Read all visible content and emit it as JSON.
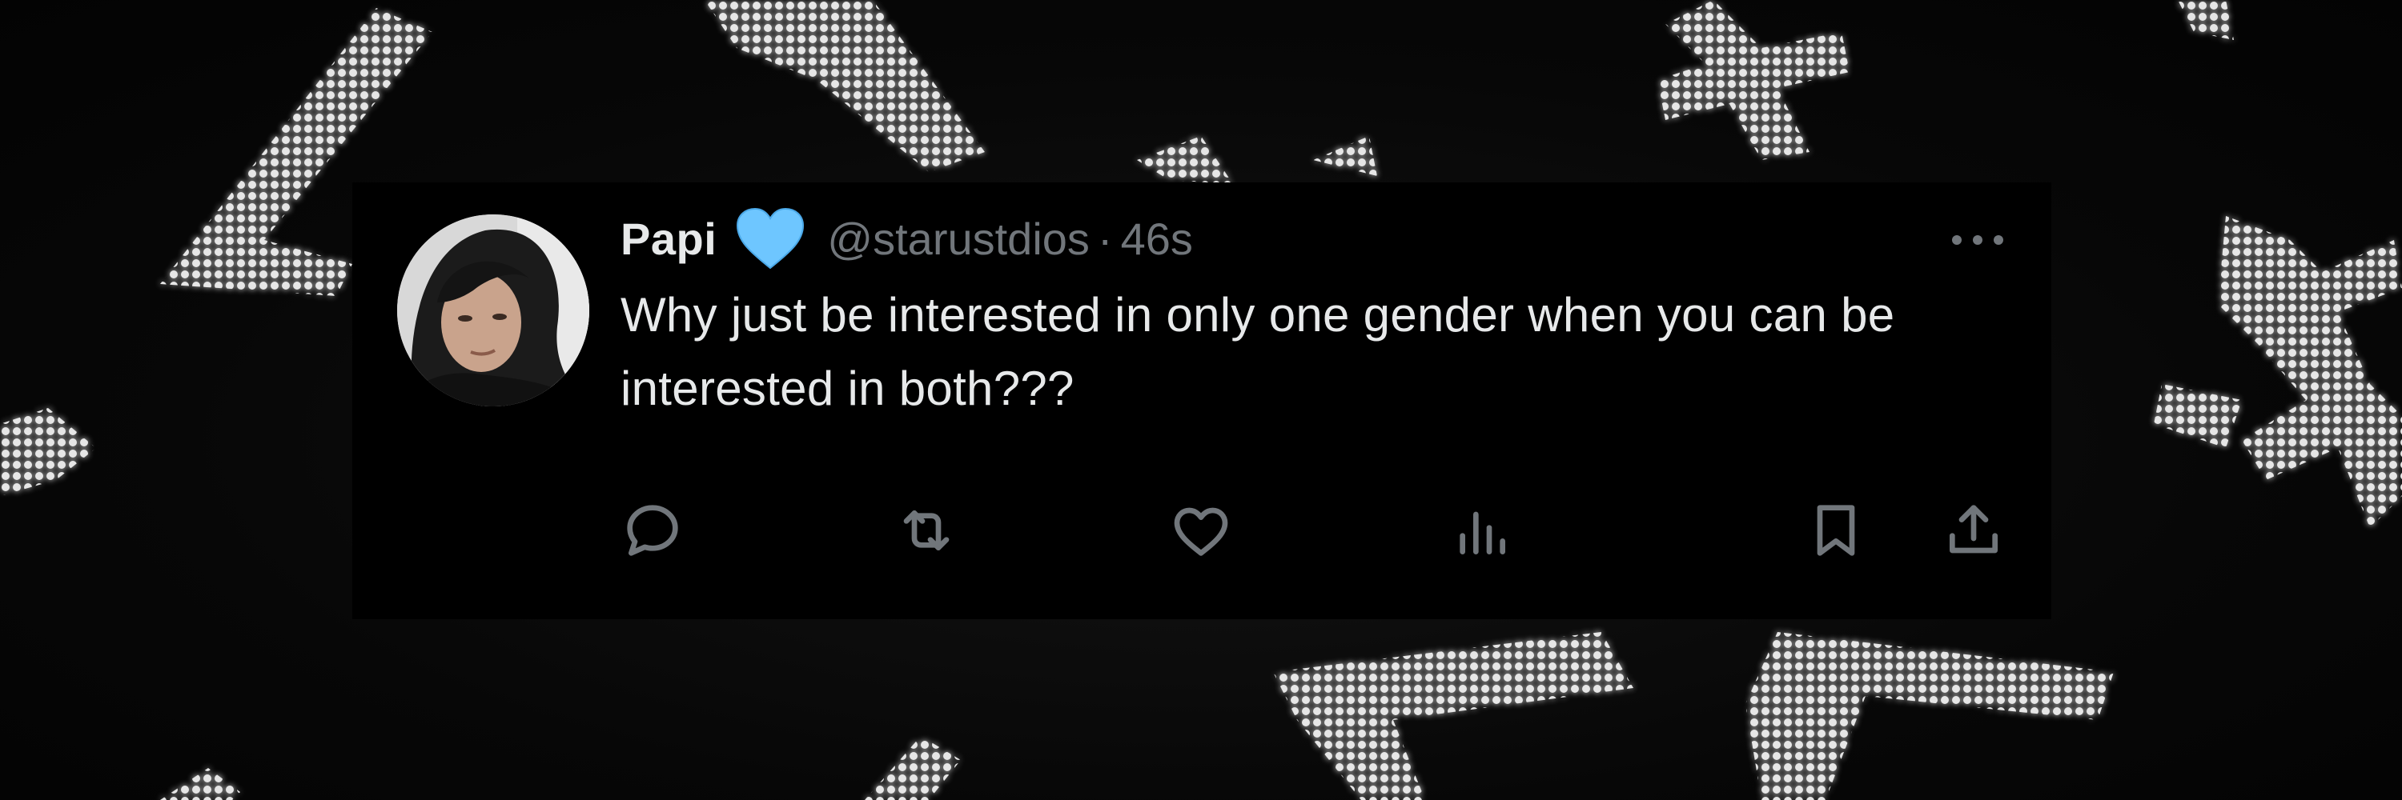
{
  "tweet": {
    "display_name": "Papi",
    "badge_icon": "blue-heart-emoji",
    "badge_color": "#6ec6ff",
    "handle": "@starustdios",
    "separator": "·",
    "timestamp": "46s",
    "text": "Why just be interested in only one gender when you can be interested in both???",
    "more_icon": "more-horizontal-icon",
    "actions": {
      "reply_icon": "reply-icon",
      "retweet_icon": "retweet-icon",
      "like_icon": "heart-icon",
      "views_icon": "views-chart-icon",
      "bookmark_icon": "bookmark-icon",
      "share_icon": "share-icon"
    }
  },
  "colors": {
    "tweet_background": "#000000",
    "primary_text": "#e7e9ea",
    "secondary_text": "#71767b",
    "banner_stars": "#f2f2f2"
  }
}
